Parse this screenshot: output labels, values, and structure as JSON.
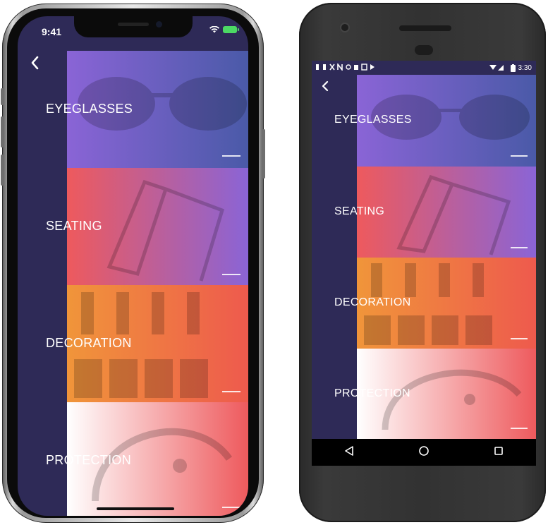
{
  "ios": {
    "time": "9:41"
  },
  "android": {
    "time": "3:30"
  },
  "app": {
    "back_icon": "chevron-left-icon",
    "categories": [
      {
        "label": "EYEGLASSES",
        "gradient": [
          "#8a64d6",
          "#4a5aa8"
        ]
      },
      {
        "label": "SEATING",
        "gradient": [
          "#ee5a5d",
          "#8a64d6"
        ]
      },
      {
        "label": "DECORATION",
        "gradient": [
          "#f0953a",
          "#ee5a4d"
        ]
      },
      {
        "label": "PROTECTION",
        "gradient": [
          "#ffffff",
          "#ee5a5d"
        ]
      }
    ],
    "sidebar_color": "#2e2a57"
  },
  "nav_icons": [
    "back-triangle-icon",
    "home-circle-icon",
    "recents-square-icon"
  ]
}
